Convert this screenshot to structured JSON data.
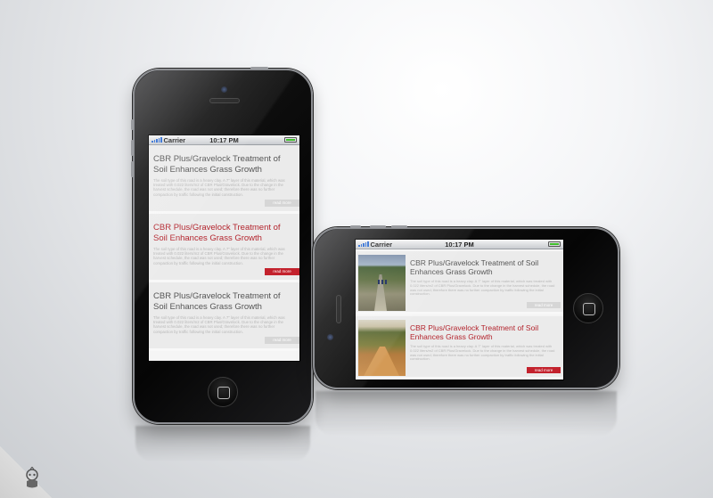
{
  "status_bar": {
    "carrier": "Carrier",
    "time": "10:17 PM"
  },
  "portrait": {
    "articles": [
      {
        "title": "CBR Plus/Gravelock Treatment of Soil Enhances Grass Growth",
        "excerpt": "The soil type of this road is a heavy clay. A 7\" layer of this material, which was treated with 0.022 liters/m2 of CBR Plus/Gravelock. Due to the change in the harvest schedule, the road was not used; therefore there was no further compaction by traffic following the initial construction.",
        "read_more": "read more"
      },
      {
        "title": "CBR Plus/Gravelock Treatment of Soil Enhances Grass Growth",
        "excerpt": "The soil type of this road is a heavy clay. A 7\" layer of this material, which was treated with 0.022 liters/m2 of CBR Plus/Gravelock. Due to the change in the harvest schedule, the road was not used; therefore there was no further compaction by traffic following the initial construction.",
        "read_more": "read more"
      },
      {
        "title": "CBR Plus/Gravelock Treatment of Soil Enhances Grass Growth",
        "excerpt": "The soil type of this road is a heavy clay. A 7\" layer of this material, which was treated with 0.022 liters/m2 of CBR Plus/Gravelock. Due to the change in the harvest schedule, the road was not used; therefore there was no further compaction by traffic following the initial construction.",
        "read_more": "read more"
      }
    ]
  },
  "landscape": {
    "articles": [
      {
        "title": "CBR Plus/Gravelock Treatment of Soil Enhances Grass Growth",
        "excerpt": "The soil type of this road is a heavy clay. A 7\" layer of this material, which was treated with 0.022 liters/m2 of CBR Plus/Gravelock. Due to the change in the harvest schedule, the road was not used; therefore there was no further compaction by traffic following the initial construction.",
        "read_more": "read more",
        "thumbnail": "road-with-people-photo"
      },
      {
        "title": "CBR Plus/Gravelock Treatment of Soil Enhances Grass Growth",
        "excerpt": "The soil type of this road is a heavy clay. A 7\" layer of this material, which was treated with 0.022 liters/m2 of CBR Plus/Gravelock. Due to the change in the harvest schedule, the road was not used; therefore there was no further compaction by traffic following the initial construction.",
        "read_more": "read more",
        "thumbnail": "dirt-road-photo"
      }
    ]
  },
  "colors": {
    "accent": "#c3222d",
    "title_gray": "#555555",
    "card_bg": "#ebebeb"
  },
  "icons": {
    "signal": "signal-bars-icon",
    "battery": "battery-icon",
    "home": "home-button-icon",
    "corner": "monkey-logo-icon"
  }
}
